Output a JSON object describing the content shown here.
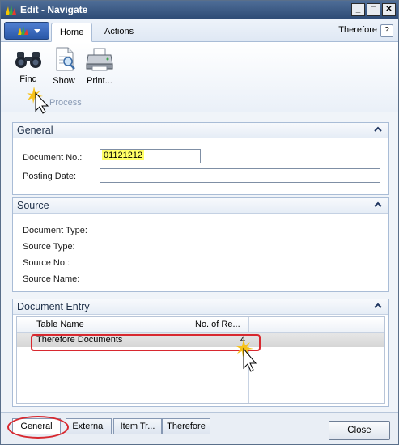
{
  "window": {
    "title": "Edit - Navigate",
    "controls": {
      "minimize": "_",
      "maximize": "□",
      "close": "✕"
    }
  },
  "ribbon": {
    "tabs": [
      {
        "label": "Home",
        "active": true
      },
      {
        "label": "Actions",
        "active": false
      }
    ],
    "right_link": "Therefore",
    "help": "?",
    "buttons": [
      {
        "label": "Find",
        "icon": "binoculars-icon"
      },
      {
        "label": "Show",
        "icon": "document-search-icon"
      },
      {
        "label": "Print...",
        "icon": "printer-icon"
      }
    ],
    "group_label": "Process"
  },
  "general": {
    "header": "General",
    "fields": [
      {
        "label": "Document No.:",
        "value": "01121212"
      },
      {
        "label": "Posting Date:",
        "value": ""
      }
    ]
  },
  "source": {
    "header": "Source",
    "fields": [
      {
        "label": "Document Type:",
        "value": ""
      },
      {
        "label": "Source Type:",
        "value": ""
      },
      {
        "label": "Source No.:",
        "value": ""
      },
      {
        "label": "Source Name:",
        "value": ""
      }
    ]
  },
  "document_entry": {
    "header": "Document Entry",
    "columns": [
      "Table Name",
      "No. of Re..."
    ],
    "rows": [
      {
        "table_name": "Therefore Documents",
        "count": "4"
      }
    ]
  },
  "bottom_tabs": [
    {
      "label": "General",
      "active": true
    },
    {
      "label": "External",
      "active": false
    },
    {
      "label": "Item Tr...",
      "active": false
    },
    {
      "label": "Therefore",
      "active": false
    }
  ],
  "close_button": "Close",
  "colors": {
    "titlebar": "#3a5a86",
    "highlight": "#ffff66",
    "annotation": "#d8282f"
  }
}
